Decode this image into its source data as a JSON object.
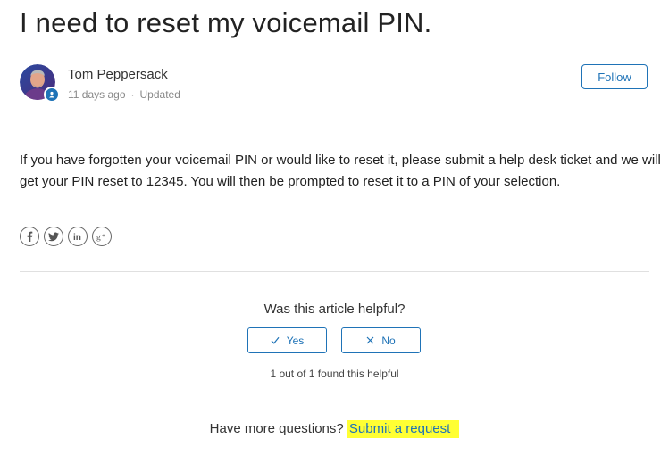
{
  "article": {
    "title": "I need to reset my voicemail PIN.",
    "body": "If you have forgotten your voicemail PIN or would like to reset it, please submit a help desk ticket and we will get your PIN reset to 12345.  You will then be prompted to reset it to a PIN of your selection."
  },
  "author": {
    "name": "Tom Peppersack",
    "time_ago": "11 days ago",
    "separator": "·",
    "updated_label": "Updated",
    "follow_label": "Follow",
    "avatar_icon": "user-avatar-photo",
    "badge_icon": "agent-badge-icon"
  },
  "share": {
    "icons": [
      "facebook-icon",
      "twitter-icon",
      "linkedin-icon",
      "google-plus-icon"
    ]
  },
  "votes": {
    "question": "Was this article helpful?",
    "yes_label": "Yes",
    "no_label": "No",
    "summary": "1 out of 1 found this helpful"
  },
  "footer": {
    "more_questions": "Have more questions?",
    "submit_request": "Submit a request"
  },
  "colors": {
    "accent": "#1f73b7",
    "highlight": "#ffff33",
    "text": "#333333",
    "muted": "#888888"
  }
}
